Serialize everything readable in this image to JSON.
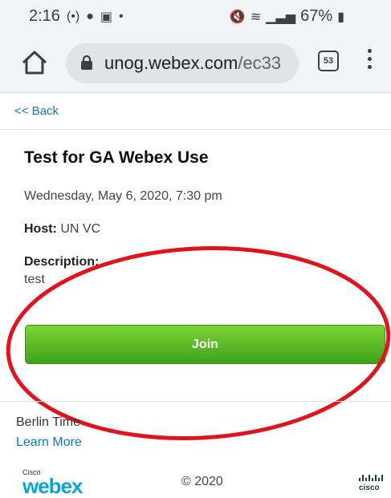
{
  "status_bar": {
    "time": "2:16",
    "battery": "67%"
  },
  "browser": {
    "url_host": "unog.webex.com",
    "url_path": "/ec33",
    "tab_count": "53"
  },
  "page": {
    "back_link": "<< Back",
    "title": "Test for GA Webex Use",
    "date": "Wednesday, May 6, 2020, 7:30 pm",
    "host_label": "Host:",
    "host_value": "UN VC",
    "description_label": "Description:",
    "description_value": "test",
    "join_button": "Join"
  },
  "footer": {
    "timezone": "Berlin Time",
    "learn_more": "Learn More",
    "logo_small": "Cisco",
    "logo_word": "webex",
    "copyright": "© 2020"
  },
  "colors": {
    "link": "#0a7bb5",
    "join_green": "#4caf22",
    "annotation_red": "#e0141e"
  }
}
